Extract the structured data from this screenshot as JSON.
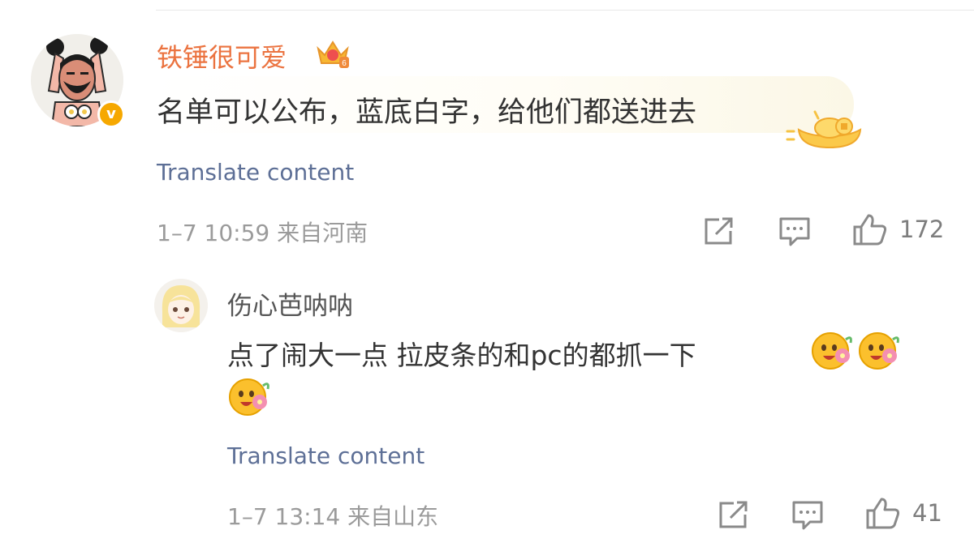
{
  "main_comment": {
    "username": "铁锤很可爱",
    "badge_icon": "crown-level-badge-icon",
    "verified_mark": "v",
    "text": "名单可以公布，蓝底白字，给他们都送进去",
    "translate_label": "Translate content",
    "meta": "1–7 10:59  来自河南",
    "like_count": "172"
  },
  "reply": {
    "username": "伤心芭呐呐",
    "text": "点了闹大一点 拉皮条的和pc的都抓一下",
    "emoji_icon": "flower-blush-emoji-icon",
    "emoji_count": 3,
    "translate_label": "Translate content",
    "meta": "1–7 13:14  来自山东",
    "like_count": "41"
  },
  "colors": {
    "username_main": "#eb7340",
    "link": "#5d6f96",
    "meta": "#9b9b9b",
    "verified": "#f6a800"
  }
}
